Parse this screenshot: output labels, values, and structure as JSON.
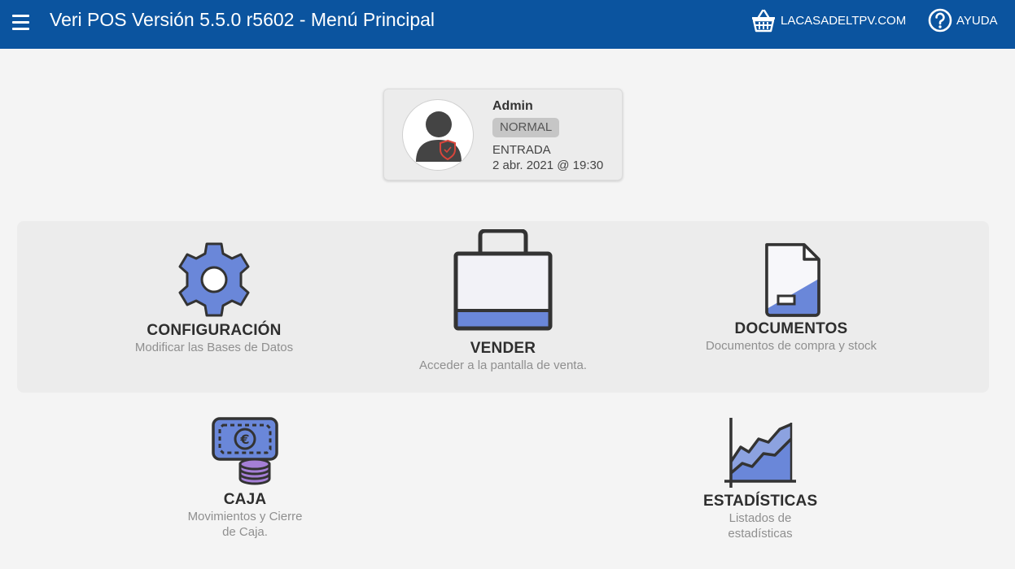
{
  "header": {
    "title": "Veri POS Versión 5.5.0 r5602 - Menú Principal",
    "shop_link": "LACASADELTPV.COM",
    "help_link": "AYUDA"
  },
  "user": {
    "name": "Admin",
    "role": "NORMAL",
    "entry_label": "ENTRADA",
    "entry_time": "2 abr. 2021 @ 19:30"
  },
  "tiles": {
    "config": {
      "title": "CONFIGURACIÓN",
      "desc": "Modificar las Bases de Datos",
      "icon": "gear-icon"
    },
    "vender": {
      "title": "VENDER",
      "desc": "Acceder a la pantalla de venta.",
      "icon": "shopping-bag-icon"
    },
    "docs": {
      "title": "DOCUMENTOS",
      "desc": "Documentos de compra y stock",
      "icon": "document-icon"
    },
    "caja": {
      "title": "CAJA",
      "desc_line1": "Movimientos y Cierre",
      "desc_line2": "de Caja.",
      "icon": "cash-register-icon"
    },
    "stats": {
      "title": "ESTADÍSTICAS",
      "desc_line1": "Listados de",
      "desc_line2": "estadísticas",
      "icon": "area-chart-icon"
    }
  },
  "colors": {
    "header_bg": "#0b549f",
    "icon_blue": "#6a87d9",
    "icon_outline": "#333333",
    "coin_purple": "#a57fd6",
    "shield_red": "#d9453b"
  }
}
